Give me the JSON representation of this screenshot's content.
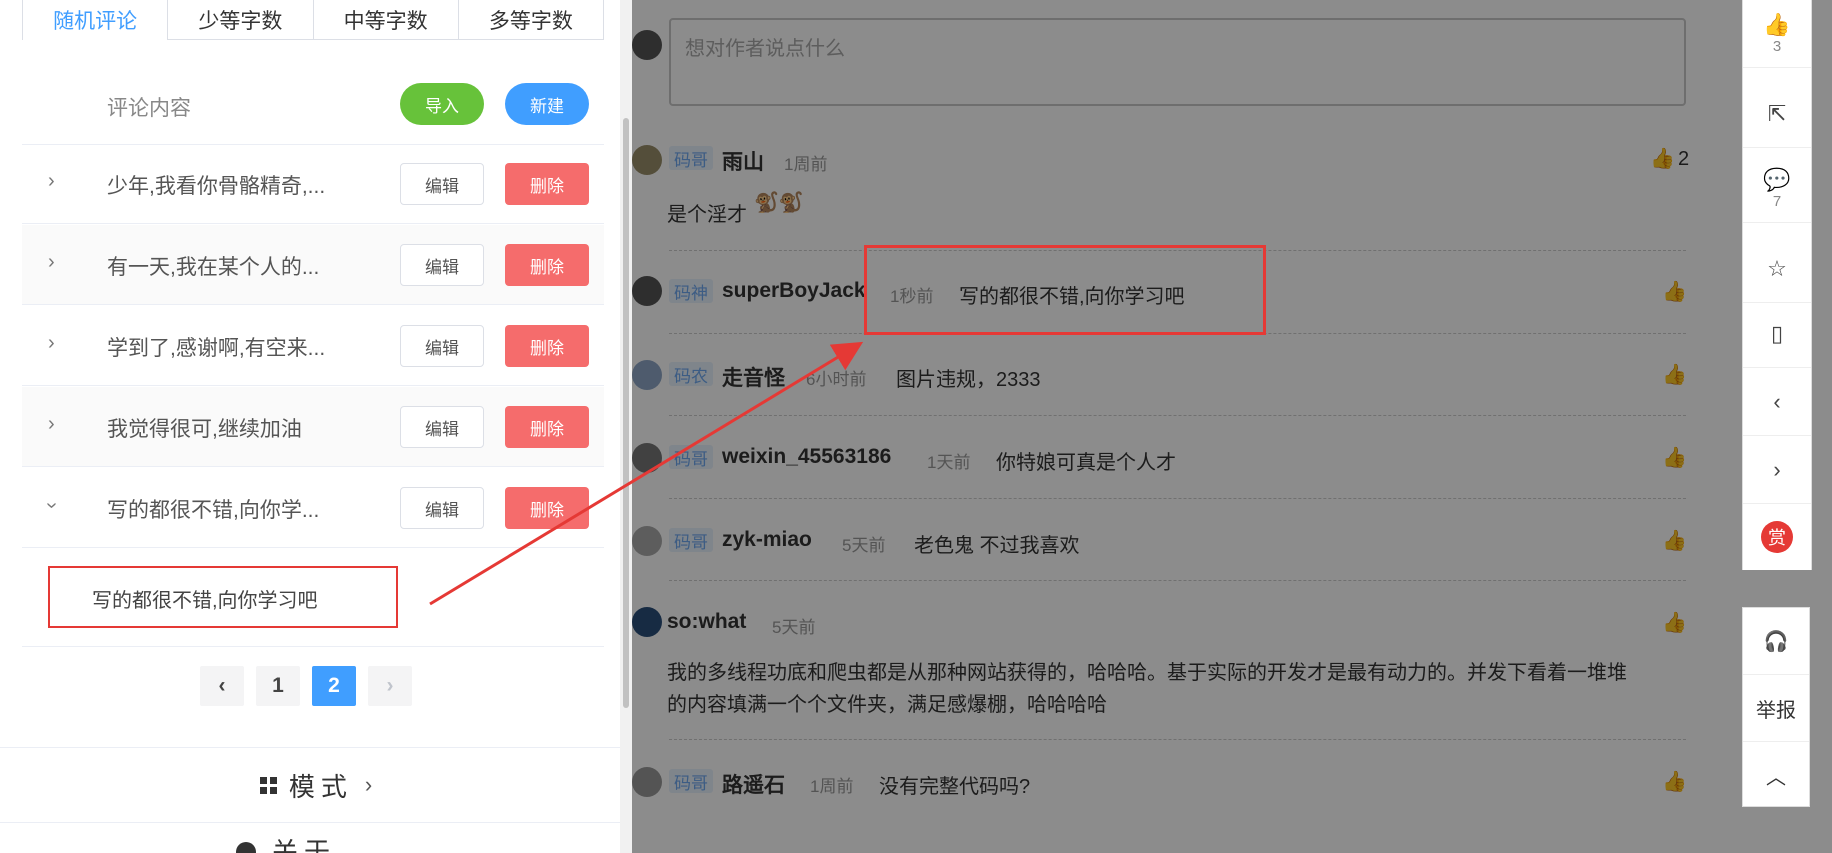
{
  "left": {
    "tabs": [
      "随机评论",
      "少等字数",
      "中等字数",
      "多等字数"
    ],
    "header_label": "评论内容",
    "import_label": "导入",
    "new_label": "新建",
    "rows": [
      {
        "text": "少年,我看你骨骼精奇,..."
      },
      {
        "text": "有一天,我在某个人的..."
      },
      {
        "text": "学到了,感谢啊,有空来..."
      },
      {
        "text": "我觉得很可,继续加油"
      },
      {
        "text": "写的都很不错,向你学..."
      }
    ],
    "edit_label": "编辑",
    "delete_label": "删除",
    "expanded_text": "写的都很不错,向你学习吧",
    "pager": {
      "prev": "‹",
      "pages": [
        "1",
        "2"
      ],
      "next": "›"
    },
    "mode_label": "模式",
    "about_label": "关于"
  },
  "right": {
    "input_placeholder": "想对作者说点什么",
    "comments": [
      {
        "badge": "码哥",
        "name": "雨山",
        "time": "1周前",
        "text": "是个淫才",
        "likes": "2"
      },
      {
        "badge": "码神",
        "name": "superBoyJack",
        "time": "1秒前",
        "text": "写的都很不错,向你学习吧"
      },
      {
        "badge": "码农",
        "name": "走音怪",
        "time": "6小时前",
        "text": "图片违规，2333"
      },
      {
        "badge": "码哥",
        "name": "weixin_45563186",
        "time": "1天前",
        "text": "你特娘可真是个人才"
      },
      {
        "badge": "码哥",
        "name": "zyk-miao",
        "time": "5天前",
        "text": "老色鬼 不过我喜欢"
      },
      {
        "name": "so:what",
        "time": "5天前",
        "text_line1": "我的多线程功底和爬虫都是从那种网站获得的，哈哈哈。基于实际的开发才是最有动力的。并发下看着一堆堆",
        "text_line2": "的内容填满一个个文件夹，满足感爆棚，哈哈哈哈"
      },
      {
        "badge": "码哥",
        "name": "路遥石",
        "time": "1周前",
        "text": "没有完整代码吗?"
      }
    ],
    "toolbar": {
      "like_count": "3",
      "comment_count": "7",
      "reward_label": "赏",
      "report_label": "举报"
    }
  },
  "colors": {
    "accent": "#409eff",
    "import": "#67c23a",
    "delete": "#f56c6c",
    "annotation": "#e53935"
  }
}
